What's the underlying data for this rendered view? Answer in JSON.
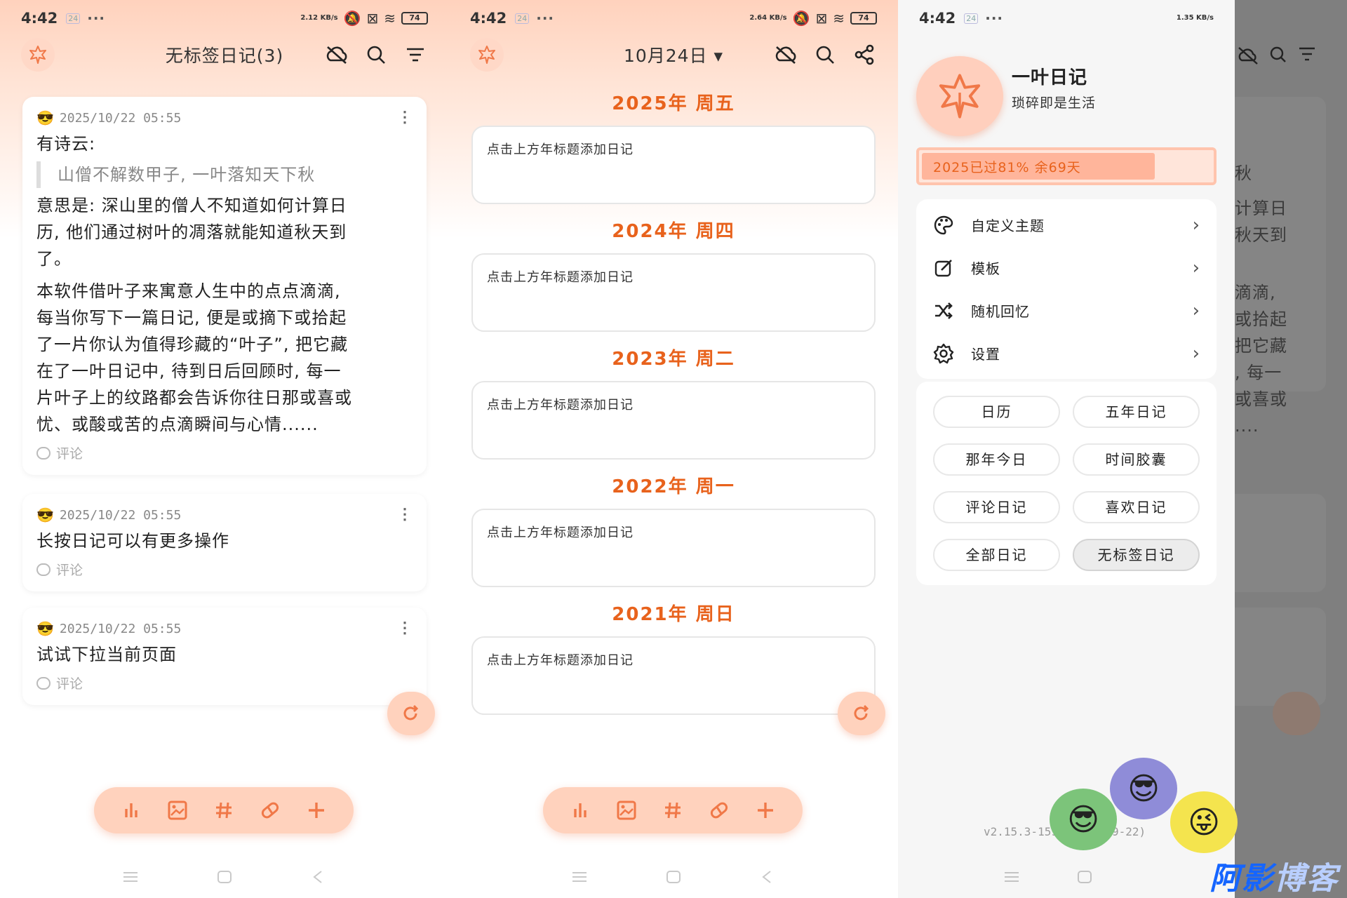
{
  "status": {
    "time": "4:42",
    "notif": "24",
    "dots": "···",
    "battery": "74",
    "speeds": [
      "2.12 KB/s",
      "2.64 KB/s",
      "1.35 KB/s"
    ]
  },
  "screen1": {
    "title": "无标签日记(3)",
    "cards": [
      {
        "date": "2025/10/22 05:55",
        "lines": [
          "有诗云:"
        ],
        "quote": "山僧不解数甲子, 一叶落知天下秋",
        "paragraph1": [
          "意思是: 深山里的僧人不知道如何计算日",
          "历, 他们通过树叶的凋落就能知道秋天到",
          "了。"
        ],
        "paragraph2": [
          "本软件借叶子来寓意人生中的点点滴滴,",
          "每当你写下一篇日记, 便是或摘下或拾起",
          "了一片你认为值得珍藏的“叶子”, 把它藏",
          "在了一叶日记中, 待到日后回顾时, 每一",
          "片叶子上的纹路都会告诉你往日那或喜或",
          "忧、或酸或苦的点滴瞬间与心情......"
        ],
        "comment": "评论"
      },
      {
        "date": "2025/10/22 05:55",
        "text": "长按日记可以有更多操作",
        "comment": "评论"
      },
      {
        "date": "2025/10/22 05:55",
        "text": "试试下拉当前页面",
        "comment": "评论"
      }
    ]
  },
  "screen2": {
    "title": "10月24日 ▾",
    "years": [
      {
        "title": "2025年 周五",
        "hint": "点击上方年标题添加日记"
      },
      {
        "title": "2024年 周四",
        "hint": "点击上方年标题添加日记"
      },
      {
        "title": "2023年 周二",
        "hint": "点击上方年标题添加日记"
      },
      {
        "title": "2022年 周一",
        "hint": "点击上方年标题添加日记"
      },
      {
        "title": "2021年 周日",
        "hint": "点击上方年标题添加日记"
      }
    ]
  },
  "drawer": {
    "name": "一叶日记",
    "subtitle": "琐碎即是生活",
    "progress_label": "2025已过81% 余69天",
    "progress_fraction": 0.81,
    "menu": [
      {
        "label": "自定义主题",
        "icon": "palette-icon"
      },
      {
        "label": "模板",
        "icon": "edit-square-icon"
      },
      {
        "label": "随机回忆",
        "icon": "shuffle-icon"
      },
      {
        "label": "设置",
        "icon": "gear-icon"
      }
    ],
    "chips": [
      "日历",
      "五年日记",
      "那年今日",
      "时间胶囊",
      "评论日记",
      "喜欢日记",
      "全部日记",
      "无标签日记"
    ],
    "active_chip": "无标签日记",
    "version": "v2.15.3-159 (2025-09-22)",
    "ghost_lines": [
      "秋",
      "计算日",
      "秋天到",
      "滴滴,",
      "或拾起",
      "把它藏",
      ", 每一",
      "或喜或",
      "...."
    ]
  },
  "colors": {
    "accent": "#e8621c",
    "peach": "#ffd2bd",
    "icon": "#f07848"
  },
  "watermark": {
    "main": "阿影",
    "fade": "博客"
  }
}
